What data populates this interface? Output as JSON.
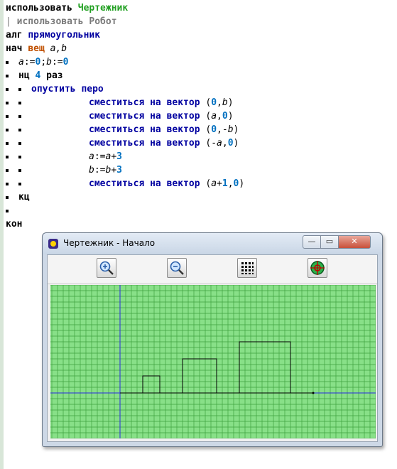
{
  "code": {
    "line1": {
      "kw": "использовать",
      "lib": "Чертежник"
    },
    "line2": {
      "bar": "|",
      "text": "использовать Робот"
    },
    "line3": {
      "kw": "алг",
      "name": "прямоугольник"
    },
    "line4": {
      "kw": "нач",
      "type": "вещ",
      "vars": "a,b"
    },
    "line5": {
      "a": "a",
      "assign1": ":=",
      "zero1": "0",
      "semi": ";",
      "b": "b",
      "assign2": ":=",
      "zero2": "0"
    },
    "line6": {
      "kw": "нц",
      "num": "4",
      "kw2": "раз"
    },
    "line7": {
      "cmd": "опустить перо"
    },
    "move_cmd": "сместиться на вектор",
    "line8": {
      "args": [
        "(",
        "0",
        ",",
        "b",
        ")"
      ]
    },
    "line9": {
      "args": [
        "(",
        "a",
        ",",
        "0",
        ")"
      ]
    },
    "line10": {
      "args": [
        "(",
        "0",
        ",-",
        "b",
        ")"
      ]
    },
    "line11": {
      "args": [
        "(-",
        "a",
        ",",
        "0",
        ")"
      ]
    },
    "line12": {
      "v": "a",
      "op": ":=",
      "v2": "a",
      "plus": "+",
      "num": "3"
    },
    "line13": {
      "v": "b",
      "op": ":=",
      "v2": "b",
      "plus": "+",
      "num": "3"
    },
    "line14": {
      "args": [
        "(",
        "a",
        "+",
        "1",
        ",",
        "0",
        ")"
      ]
    },
    "line15": {
      "kw": "кц"
    },
    "line17": {
      "kw": "кон"
    }
  },
  "window": {
    "title": "Чертежник - Начало",
    "minimize_glyph": "—",
    "maximize_glyph": "▭",
    "close_glyph": "✕",
    "toolbar_icons": [
      "zoom-in-icon",
      "zoom-out-icon",
      "grid-dots-icon",
      "target-icon"
    ]
  },
  "colors": {
    "canvas_bg": "#88e088",
    "grid": "#3fa23f",
    "axis": "#2a2ae0",
    "drawing": "#000000"
  }
}
